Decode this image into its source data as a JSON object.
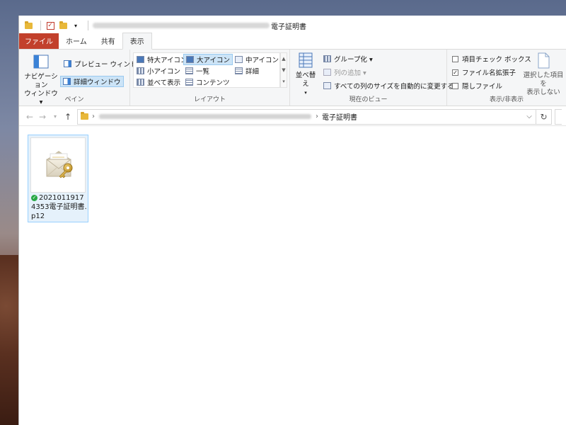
{
  "window": {
    "title": "電子証明書"
  },
  "tabs": [
    {
      "label": "ファイル"
    },
    {
      "label": "ホーム"
    },
    {
      "label": "共有"
    },
    {
      "label": "表示"
    }
  ],
  "ribbon": {
    "pane": {
      "label": "ペイン",
      "nav_pane": "ナビゲーション\nウィンドウ ▾",
      "preview_pane": "プレビュー ウィンドウ",
      "details_pane": "詳細ウィンドウ"
    },
    "layout": {
      "label": "レイアウト",
      "items": [
        {
          "label": "特大アイコン"
        },
        {
          "label": "大アイコン"
        },
        {
          "label": "中アイコン"
        },
        {
          "label": "小アイコン"
        },
        {
          "label": "一覧"
        },
        {
          "label": "詳細"
        },
        {
          "label": "並べて表示"
        },
        {
          "label": "コンテンツ"
        }
      ]
    },
    "current_view": {
      "label": "現在のビュー",
      "sort": "並べ替え",
      "group_by": "グループ化 ▾",
      "add_columns": "列の追加 ▾",
      "size_all_columns": "すべての列のサイズを自動的に変更する"
    },
    "show_hide": {
      "label": "表示/非表示",
      "item_checkboxes": "項目チェック ボックス",
      "file_extensions": "ファイル名拡張子",
      "hidden_items": "隠しファイル",
      "hide_selected": "選択した項目を\n表示しない"
    }
  },
  "address": {
    "current": "電子証明書"
  },
  "file": {
    "name": "20210119174353電子証明書.p12"
  },
  "colors": {
    "file_tab": "#c2402c",
    "selection": "#cce4f7",
    "sync_ok": "#27a844"
  }
}
